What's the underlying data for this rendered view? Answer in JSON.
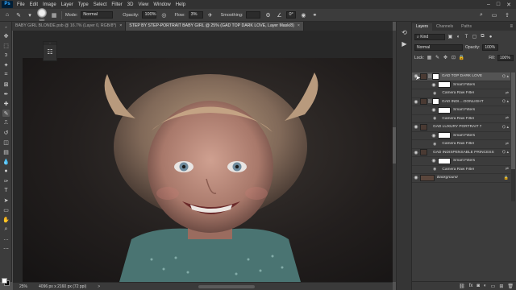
{
  "menubar": {
    "logo": "Ps",
    "items": [
      "File",
      "Edit",
      "Image",
      "Layer",
      "Type",
      "Select",
      "Filter",
      "3D",
      "View",
      "Window",
      "Help"
    ],
    "window_buttons": [
      "–",
      "□",
      "✕"
    ]
  },
  "options": {
    "brush_size": "600",
    "mode_label": "Mode:",
    "mode_value": "Normal",
    "opacity_label": "Opacity:",
    "opacity_value": "100%",
    "flow_label": "Flow:",
    "flow_value": "3%",
    "smoothing_label": "Smoothing:",
    "smoothing_value": "",
    "angle_value": "0°"
  },
  "tabs": [
    {
      "label": "BABY GIRL BLONDE.psb @ 16.7% (Layer 0, RGB/8*)",
      "close": "×"
    },
    {
      "label": "STEP BY STEP-PORTRAIT BABY GIRL @ 25% (GAD TOP DARK LOVE, Layer Mask/8)",
      "close": "×"
    }
  ],
  "status": {
    "zoom": "25%",
    "doc_info": "4096 px x 2160 px (72 ppi)",
    "arrow": ">"
  },
  "layers_panel": {
    "tabs": [
      "Layers",
      "Channels",
      "Paths"
    ],
    "kind_label": "Kind",
    "blend_mode": "Normal",
    "opacity_label": "Opacity:",
    "opacity_value": "100%",
    "lock_label": "Lock:",
    "fill_label": "Fill:",
    "fill_value": "100%",
    "layers": [
      {
        "type": "layer",
        "name": "GAD TOP DARK LOVE",
        "selected": true
      },
      {
        "type": "filters",
        "name": "Smart Filters"
      },
      {
        "type": "filter",
        "name": "Camera Raw Filter"
      },
      {
        "type": "layer",
        "name": "GAD INDI....OONLIGHT",
        "selected": false
      },
      {
        "type": "filters",
        "name": "Smart Filters"
      },
      {
        "type": "filter",
        "name": "Camera Raw Filter"
      },
      {
        "type": "layer",
        "name": "GAD LUXURY PORTRAIT 7",
        "selected": false
      },
      {
        "type": "filters",
        "name": "Smart Filters"
      },
      {
        "type": "filter",
        "name": "Camera Raw Filter"
      },
      {
        "type": "layer",
        "name": "GAD INDISPENSABLE PRINCESS",
        "selected": false
      },
      {
        "type": "filters",
        "name": "Smart Filters"
      },
      {
        "type": "filter",
        "name": "Camera Raw Filter"
      },
      {
        "type": "background",
        "name": "Background",
        "selected": false
      }
    ]
  }
}
